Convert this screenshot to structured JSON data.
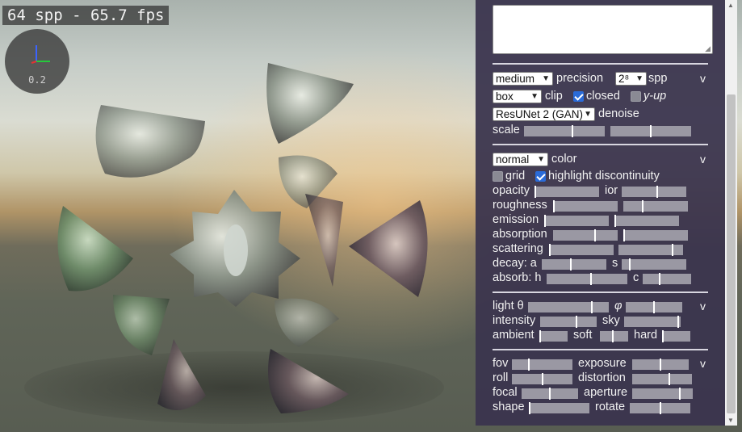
{
  "overlay": {
    "fps_text": "64 spp - 65.7 fps",
    "zoom": "0.2"
  },
  "panel": {
    "render": {
      "precision_value": "medium",
      "precision_label": "precision",
      "spp_value": "2⁸",
      "spp_label": "spp",
      "collapse": "v",
      "clip_value": "box",
      "clip_label": "clip",
      "closed_label": "closed",
      "closed_checked": true,
      "yup_label": "y-up",
      "yup_checked": false,
      "denoise_value": "ResUNet 2 (GAN)",
      "denoise_label": "denoise",
      "scale_label": "scale",
      "scale_slider_1": 0.6,
      "scale_slider_2": 0.5
    },
    "material": {
      "color_value": "normal",
      "color_label": "color",
      "collapse": "v",
      "grid_label": "grid",
      "grid_checked": false,
      "highlight_label": "highlight discontinuity",
      "highlight_checked": true,
      "opacity_label": "opacity",
      "opacity_slider": 0.0,
      "ior_label": "ior",
      "ior_slider": 0.55,
      "roughness_label": "roughness",
      "roughness_slider": 0.0,
      "roughness_slider_2": 0.3,
      "emission_label": "emission",
      "emission_slider": 0.0,
      "emission_slider_2": 0.0,
      "absorption_label": "absorption",
      "absorption_slider": 0.65,
      "absorption_slider_2": 0.0,
      "scattering_label": "scattering",
      "scattering_slider": 0.0,
      "scattering_slider_2": 0.85,
      "decay_label": "decay: a",
      "decay_a_slider": 0.45,
      "decay_s_label": "s",
      "decay_s_slider": 0.12,
      "absorb_label": "absorb: h",
      "absorb_h_slider": 0.55,
      "absorb_c_label": "c",
      "absorb_c_slider": 0.35
    },
    "light": {
      "light_label": "light θ",
      "theta_slider": 0.8,
      "phi_label": "φ",
      "phi_slider": 0.5,
      "collapse": "v",
      "intensity_label": "intensity",
      "intensity_slider": 0.65,
      "sky_label": "sky",
      "sky_slider": 0.97,
      "ambient_label": "ambient",
      "ambient_slider": 0.0,
      "soft_label": "soft",
      "soft_slider": 0.45,
      "hard_label": "hard",
      "hard_slider": 0.0
    },
    "camera": {
      "fov_label": "fov",
      "fov_slider": 0.27,
      "exposure_label": "exposure",
      "exposure_slider": 0.5,
      "collapse": "v",
      "roll_label": "roll",
      "roll_slider": 0.5,
      "distortion_label": "distortion",
      "distortion_slider": 0.62,
      "focal_label": "focal",
      "focal_slider": 0.5,
      "aperture_label": "aperture",
      "aperture_slider": 0.8,
      "shape_label": "shape",
      "shape_slider": 0.0,
      "rotate_label": "rotate",
      "rotate_slider": 0.5
    }
  }
}
